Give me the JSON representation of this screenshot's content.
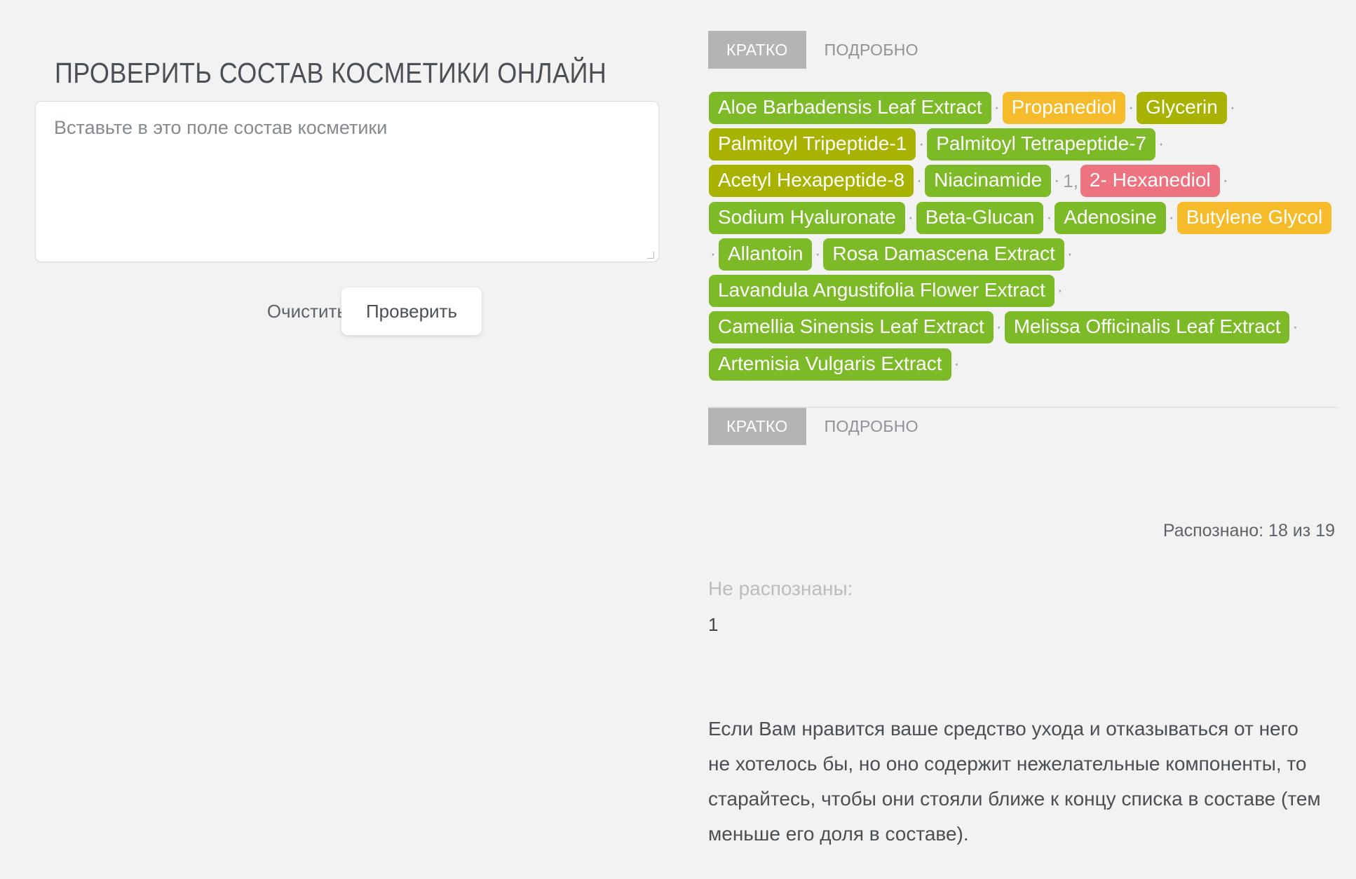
{
  "header": {
    "title": "ПРОВЕРИТЬ СОСТАВ КОСМЕТИКИ ОНЛАЙН"
  },
  "form": {
    "textarea_placeholder": "Вставьте в это поле состав косметики",
    "textarea_value": "",
    "clear_label": "Очистить",
    "check_label": "Проверить"
  },
  "tabs_top": [
    {
      "label": "КРАТКО",
      "active": true
    },
    {
      "label": "ПОДРОБНО",
      "active": false
    }
  ],
  "tabs_bottom": [
    {
      "label": "КРАТКО",
      "active": true
    },
    {
      "label": "ПОДРОБНО",
      "active": false
    }
  ],
  "separator": "·",
  "ingredient_rows": [
    [
      {
        "type": "tag",
        "text": "Aloe Barbadensis Leaf Extract",
        "rating": "good"
      },
      {
        "type": "sep",
        "text": "·"
      },
      {
        "type": "tag",
        "text": "Propanediol",
        "rating": "warn"
      },
      {
        "type": "sep",
        "text": "·"
      },
      {
        "type": "tag",
        "text": "Glycerin",
        "rating": "ok"
      },
      {
        "type": "sep",
        "text": "·"
      }
    ],
    [
      {
        "type": "tag",
        "text": "Palmitoyl Tripeptide-1",
        "rating": "ok"
      },
      {
        "type": "sep",
        "text": "·"
      },
      {
        "type": "tag",
        "text": "Palmitoyl Tetrapeptide-7",
        "rating": "good"
      },
      {
        "type": "sep",
        "text": "·"
      }
    ],
    [
      {
        "type": "tag",
        "text": "Acetyl Hexapeptide-8",
        "rating": "ok"
      },
      {
        "type": "sep",
        "text": "·"
      },
      {
        "type": "tag",
        "text": "Niacinamide",
        "rating": "good"
      },
      {
        "type": "sep",
        "text": "·"
      },
      {
        "type": "plain",
        "text": "1,"
      },
      {
        "type": "tag",
        "text": "2- Hexanediol",
        "rating": "bad"
      },
      {
        "type": "sep",
        "text": "·"
      }
    ],
    [
      {
        "type": "tag",
        "text": "Sodium Hyaluronate",
        "rating": "good"
      },
      {
        "type": "sep",
        "text": "·"
      },
      {
        "type": "tag",
        "text": "Beta-Glucan",
        "rating": "good"
      },
      {
        "type": "sep",
        "text": "·"
      },
      {
        "type": "tag",
        "text": "Adenosine",
        "rating": "good"
      },
      {
        "type": "sep",
        "text": "·"
      },
      {
        "type": "tag",
        "text": "Butylene Glycol",
        "rating": "warn"
      }
    ],
    [
      {
        "type": "sep",
        "text": "·"
      },
      {
        "type": "tag",
        "text": "Allantoin",
        "rating": "good"
      },
      {
        "type": "sep",
        "text": "·"
      },
      {
        "type": "tag",
        "text": "Rosa Damascena Extract",
        "rating": "good"
      },
      {
        "type": "sep",
        "text": "·"
      }
    ],
    [
      {
        "type": "tag",
        "text": "Lavandula Angustifolia Flower Extract",
        "rating": "good"
      },
      {
        "type": "sep",
        "text": "·"
      }
    ],
    [
      {
        "type": "tag",
        "text": "Camellia Sinensis Leaf Extract",
        "rating": "good"
      },
      {
        "type": "sep",
        "text": "·"
      },
      {
        "type": "tag",
        "text": "Melissa Officinalis Leaf Extract",
        "rating": "good"
      },
      {
        "type": "sep",
        "text": "·"
      }
    ],
    [
      {
        "type": "tag",
        "text": "Artemisia Vulgaris Extract",
        "rating": "good"
      },
      {
        "type": "sep",
        "text": "·"
      }
    ]
  ],
  "results": {
    "recognized_text": "Распознано: 18 из 19",
    "unrecognized_label": "Не распознаны:",
    "unrecognized_items": "1"
  },
  "note": {
    "text": "Если Вам нравится ваше средство ухода и отказываться от него не хотелось бы, но оно содержит нежелательные компоненты, то старайтесь, чтобы они стояли ближе к концу списка в составе (тем меньше его доля в составе)."
  },
  "colors": {
    "background": "#f2f2f2",
    "good": "#7cba27",
    "ok": "#a7b300",
    "warn": "#f5bb2a",
    "bad": "#ee7380",
    "tab_active_bg": "#b4b4b4",
    "text": "#4b5057",
    "muted": "#8d9399"
  }
}
